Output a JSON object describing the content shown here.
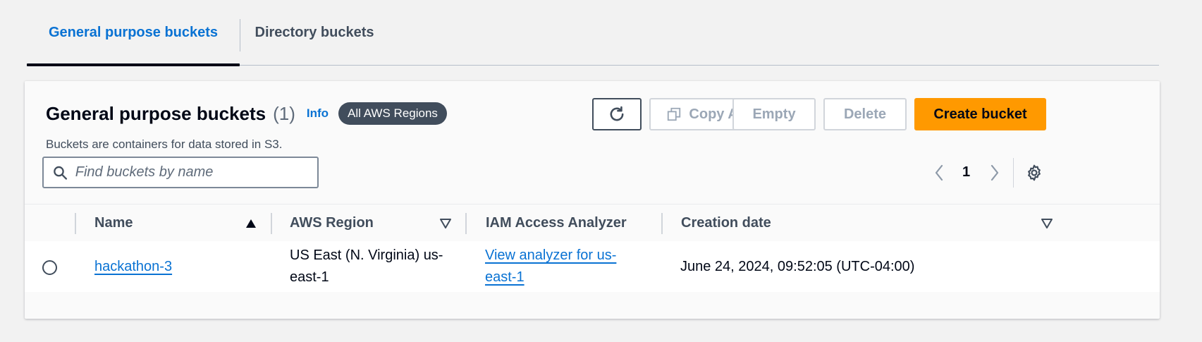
{
  "tabs": [
    {
      "label": "General purpose buckets",
      "active": true
    },
    {
      "label": "Directory buckets",
      "active": false
    }
  ],
  "header": {
    "title": "General purpose buckets",
    "count": "(1)",
    "info": "Info",
    "region_badge": "All AWS Regions",
    "description": "Buckets are containers for data stored in S3."
  },
  "actions": {
    "refresh_icon": "refresh-icon",
    "copy_arn": "Copy ARN",
    "empty": "Empty",
    "delete": "Delete",
    "create": "Create bucket"
  },
  "search": {
    "placeholder": "Find buckets by name",
    "value": ""
  },
  "pagination": {
    "current_page": "1"
  },
  "table": {
    "columns": [
      "Name",
      "AWS Region",
      "IAM Access Analyzer",
      "Creation date"
    ],
    "rows": [
      {
        "name": "hackathon-3",
        "region_line1": "US East (N. Virginia) us-",
        "region_line2": "east-1",
        "analyzer_line1": "View analyzer for us-",
        "analyzer_line2": "east-1",
        "created": "June 24, 2024, 09:52:05 (UTC-04:00)"
      }
    ]
  },
  "colors": {
    "accent": "#0972d3",
    "primary_button": "#ff9900",
    "badge": "#414d5c"
  }
}
